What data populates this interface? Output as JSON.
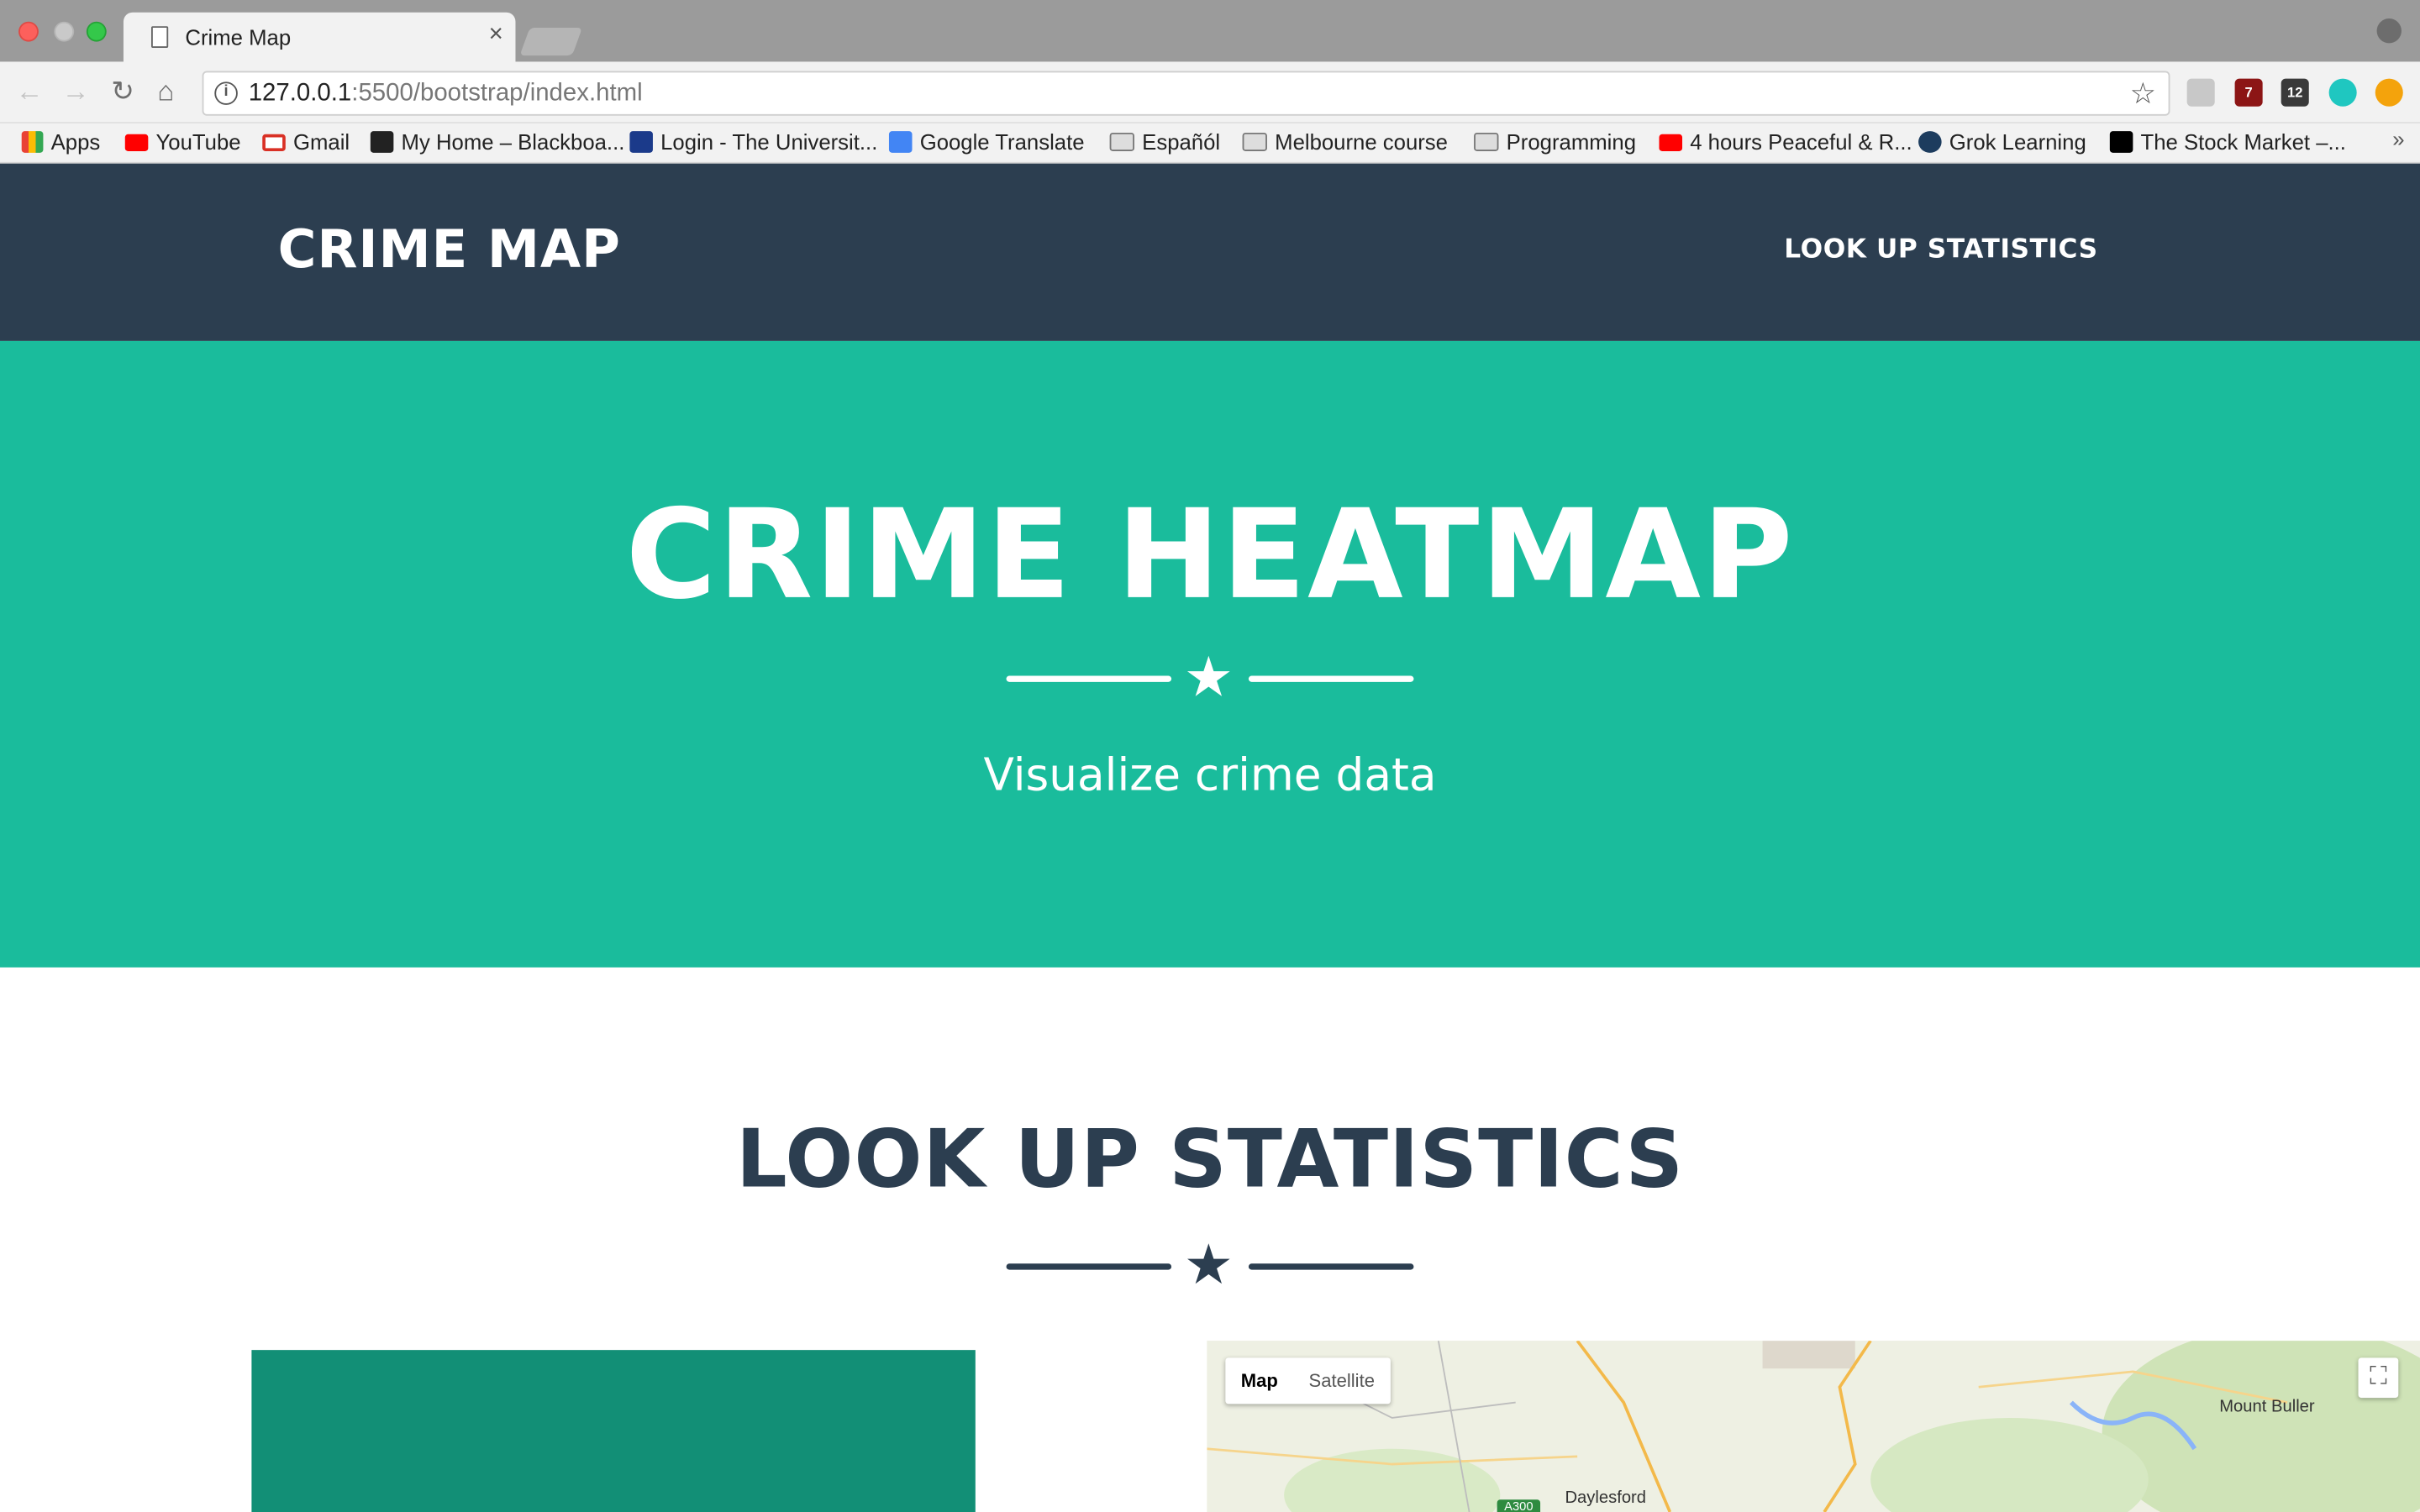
{
  "browser": {
    "tab_title": "Crime Map",
    "tab_close": "×",
    "url_host": "127.0.0.1",
    "url_rest": ":5500/bootstrap/index.html",
    "bookmarks": [
      "Apps",
      "YouTube",
      "Gmail",
      "My Home – Blackboa...",
      "Login - The Universit...",
      "Google Translate",
      "Españól",
      "Melbourne course",
      "Programming",
      "4 hours Peaceful & R...",
      "Grok Learning",
      "The Stock Market –..."
    ],
    "extension_badges": [
      "7",
      "12"
    ],
    "more_bookmarks": "»"
  },
  "navbar": {
    "brand": "CRIME MAP",
    "link": "LOOK UP STATISTICS"
  },
  "hero": {
    "title": "CRIME HEATMAP",
    "subtitle": "Visualize crime data",
    "star": "★"
  },
  "section": {
    "title": "LOOK UP STATISTICS",
    "star": "★"
  },
  "map": {
    "type_map": "Map",
    "type_satellite": "Satellite",
    "labels": [
      "Mount Buller",
      "Daylesford"
    ],
    "road_shield": "A300",
    "fullscreen": "⛶"
  },
  "colors": {
    "navbar": "#2c3e50",
    "hero": "#1abc9c",
    "panel": "#128f76"
  }
}
